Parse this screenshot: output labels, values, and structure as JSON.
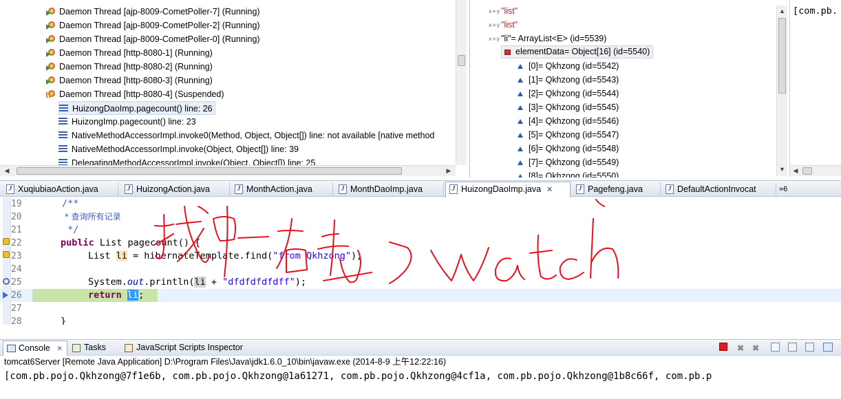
{
  "debug": {
    "threads": [
      {
        "label": "Daemon Thread [ajp-8009-CometPoller-7] (Running)",
        "state": "running"
      },
      {
        "label": "Daemon Thread [ajp-8009-CometPoller-2] (Running)",
        "state": "running"
      },
      {
        "label": "Daemon Thread [ajp-8009-CometPoller-0] (Running)",
        "state": "running"
      },
      {
        "label": "Daemon Thread [http-8080-1] (Running)",
        "state": "running"
      },
      {
        "label": "Daemon Thread [http-8080-2] (Running)",
        "state": "running"
      },
      {
        "label": "Daemon Thread [http-8080-3] (Running)",
        "state": "running"
      },
      {
        "label": "Daemon Thread [http-8080-4] (Suspended)",
        "state": "suspended"
      }
    ],
    "frames": [
      "HuizongDaoImp.pagecount() line: 26",
      "HuizongImp.pagecount() line: 23",
      "NativeMethodAccessorImpl.invoke0(Method, Object, Object[]) line: not available [native method",
      "NativeMethodAccessorImpl.invoke(Object, Object[]) line: 39",
      "DelegatingMethodAccessorImpl.invoke(Object, Object[]) line: 25"
    ]
  },
  "variables": {
    "rows": [
      {
        "text": "\"list\"",
        "kind": "string"
      },
      {
        "text": "\"list\"",
        "kind": "string"
      },
      {
        "text": "\"li\"= ArrayList<E>  (id=5539)",
        "kind": "var"
      },
      {
        "text": "elementData= Object[16]  (id=5540)",
        "kind": "field"
      },
      {
        "text": "[0]= Qkhzong  (id=5542)",
        "kind": "item"
      },
      {
        "text": "[1]= Qkhzong  (id=5543)",
        "kind": "item"
      },
      {
        "text": "[2]= Qkhzong  (id=5544)",
        "kind": "item"
      },
      {
        "text": "[3]= Qkhzong  (id=5545)",
        "kind": "item"
      },
      {
        "text": "[4]= Qkhzong  (id=5546)",
        "kind": "item"
      },
      {
        "text": "[5]= Qkhzong  (id=5547)",
        "kind": "item"
      },
      {
        "text": "[6]= Qkhzong  (id=5548)",
        "kind": "item"
      },
      {
        "text": "[7]= Qkhzong  (id=5549)",
        "kind": "item"
      },
      {
        "text": "[8]= Qkhzong  (id=5550)",
        "kind": "item"
      }
    ],
    "xy_icon": "x+y",
    "detail_text": "[com.pb."
  },
  "editor_tabs": [
    {
      "label": "XuqiubiaoAction.java",
      "active": false
    },
    {
      "label": "HuizongAction.java",
      "active": false
    },
    {
      "label": "MonthAction.java",
      "active": false
    },
    {
      "label": "MonthDaoImp.java",
      "active": false
    },
    {
      "label": "HuizongDaoImp.java",
      "active": true
    },
    {
      "label": "Pagefeng.java",
      "active": false
    },
    {
      "label": "DefaultActionInvocat",
      "active": false
    }
  ],
  "editor_tabs_overflow": "»6",
  "editor_tabs_close": "✕",
  "code": {
    "line_numbers": [
      "19",
      "20",
      "21",
      "22",
      "23",
      "24",
      "25",
      "26",
      "27",
      "28"
    ],
    "l19": "/**",
    "l20": " * 查询所有记录",
    "l21": " */",
    "l22_kw": "public",
    "l22_rest": " List pagecount() {",
    "l23_type": "List ",
    "l23_var": "li",
    "l23_mid": " = hibernateTemplate.find(",
    "l23_str": "\"from Qkhzong\"",
    "l23_end": ");",
    "l25_a": "System.",
    "l25_out": "out",
    "l25_b": ".println(",
    "l25_var": "li",
    "l25_c": " + ",
    "l25_str": "\"dfdfdfdfdff\"",
    "l25_end": ");",
    "l26_kw": "return",
    "l26_var": "li",
    "l26_end": ";",
    "l28": "}"
  },
  "console": {
    "tabs": [
      {
        "label": "Console",
        "active": true
      },
      {
        "label": "Tasks",
        "active": false
      },
      {
        "label": "JavaScript Scripts Inspector",
        "active": false
      }
    ],
    "close": "✕",
    "header": "tomcat6Server [Remote Java Application] D:\\Program Files\\Java\\jdk1.6.0_10\\bin\\javaw.exe (2014-8-9 上午12:22:16)",
    "output": "[com.pb.pojo.Qkhzong@7f1e6b, com.pb.pojo.Qkhzong@1a61271, com.pb.pojo.Qkhzong@4cf1a, com.pb.pojo.Qkhzong@1b8c66f, com.pb.p"
  },
  "colors": {
    "annotation": "#e8101e",
    "keyword": "#7f0055",
    "string": "#2a00ff",
    "comment": "#3f5fbf",
    "current_line": "#c9e4a8"
  }
}
